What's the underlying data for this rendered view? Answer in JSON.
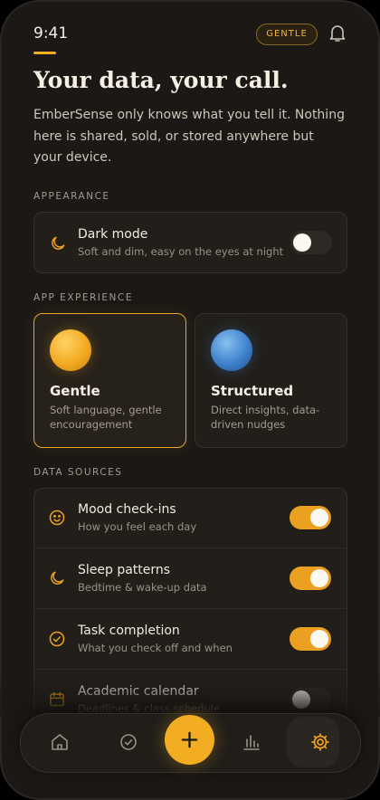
{
  "status": {
    "time": "9:41",
    "mode_badge": "GENTLE"
  },
  "header": {
    "title": "Your data, your call.",
    "intro": "EmberSense only knows what you tell it. Nothing here is shared, sold, or stored anywhere but your device."
  },
  "appearance": {
    "label": "APPEARANCE",
    "dark_mode": {
      "title": "Dark mode",
      "subtitle": "Soft and dim, easy on the eyes at night",
      "enabled": false
    }
  },
  "experience": {
    "label": "APP EXPERIENCE",
    "options": [
      {
        "title": "Gentle",
        "description": "Soft language, gentle encouragement",
        "selected": true
      },
      {
        "title": "Structured",
        "description": "Direct insights, data-driven nudges",
        "selected": false
      }
    ]
  },
  "sources": {
    "label": "DATA SOURCES",
    "items": [
      {
        "title": "Mood check-ins",
        "subtitle": "How you feel each day",
        "enabled": true,
        "icon": "smile-icon"
      },
      {
        "title": "Sleep patterns",
        "subtitle": "Bedtime & wake-up data",
        "enabled": true,
        "icon": "moon-icon"
      },
      {
        "title": "Task completion",
        "subtitle": "What you check off and when",
        "enabled": true,
        "icon": "check-circle-icon"
      },
      {
        "title": "Academic calendar",
        "subtitle": "Deadlines & class schedule",
        "enabled": false,
        "icon": "calendar-icon"
      }
    ]
  },
  "nav": {
    "items": [
      "home-icon",
      "check-circle-icon",
      "plus-icon",
      "bar-chart-icon",
      "gear-icon"
    ],
    "active": "gear-icon"
  },
  "colors": {
    "accent": "#f2ad22",
    "background": "#1b1815",
    "card": "#221f1b",
    "blue": "#3f82cc"
  }
}
